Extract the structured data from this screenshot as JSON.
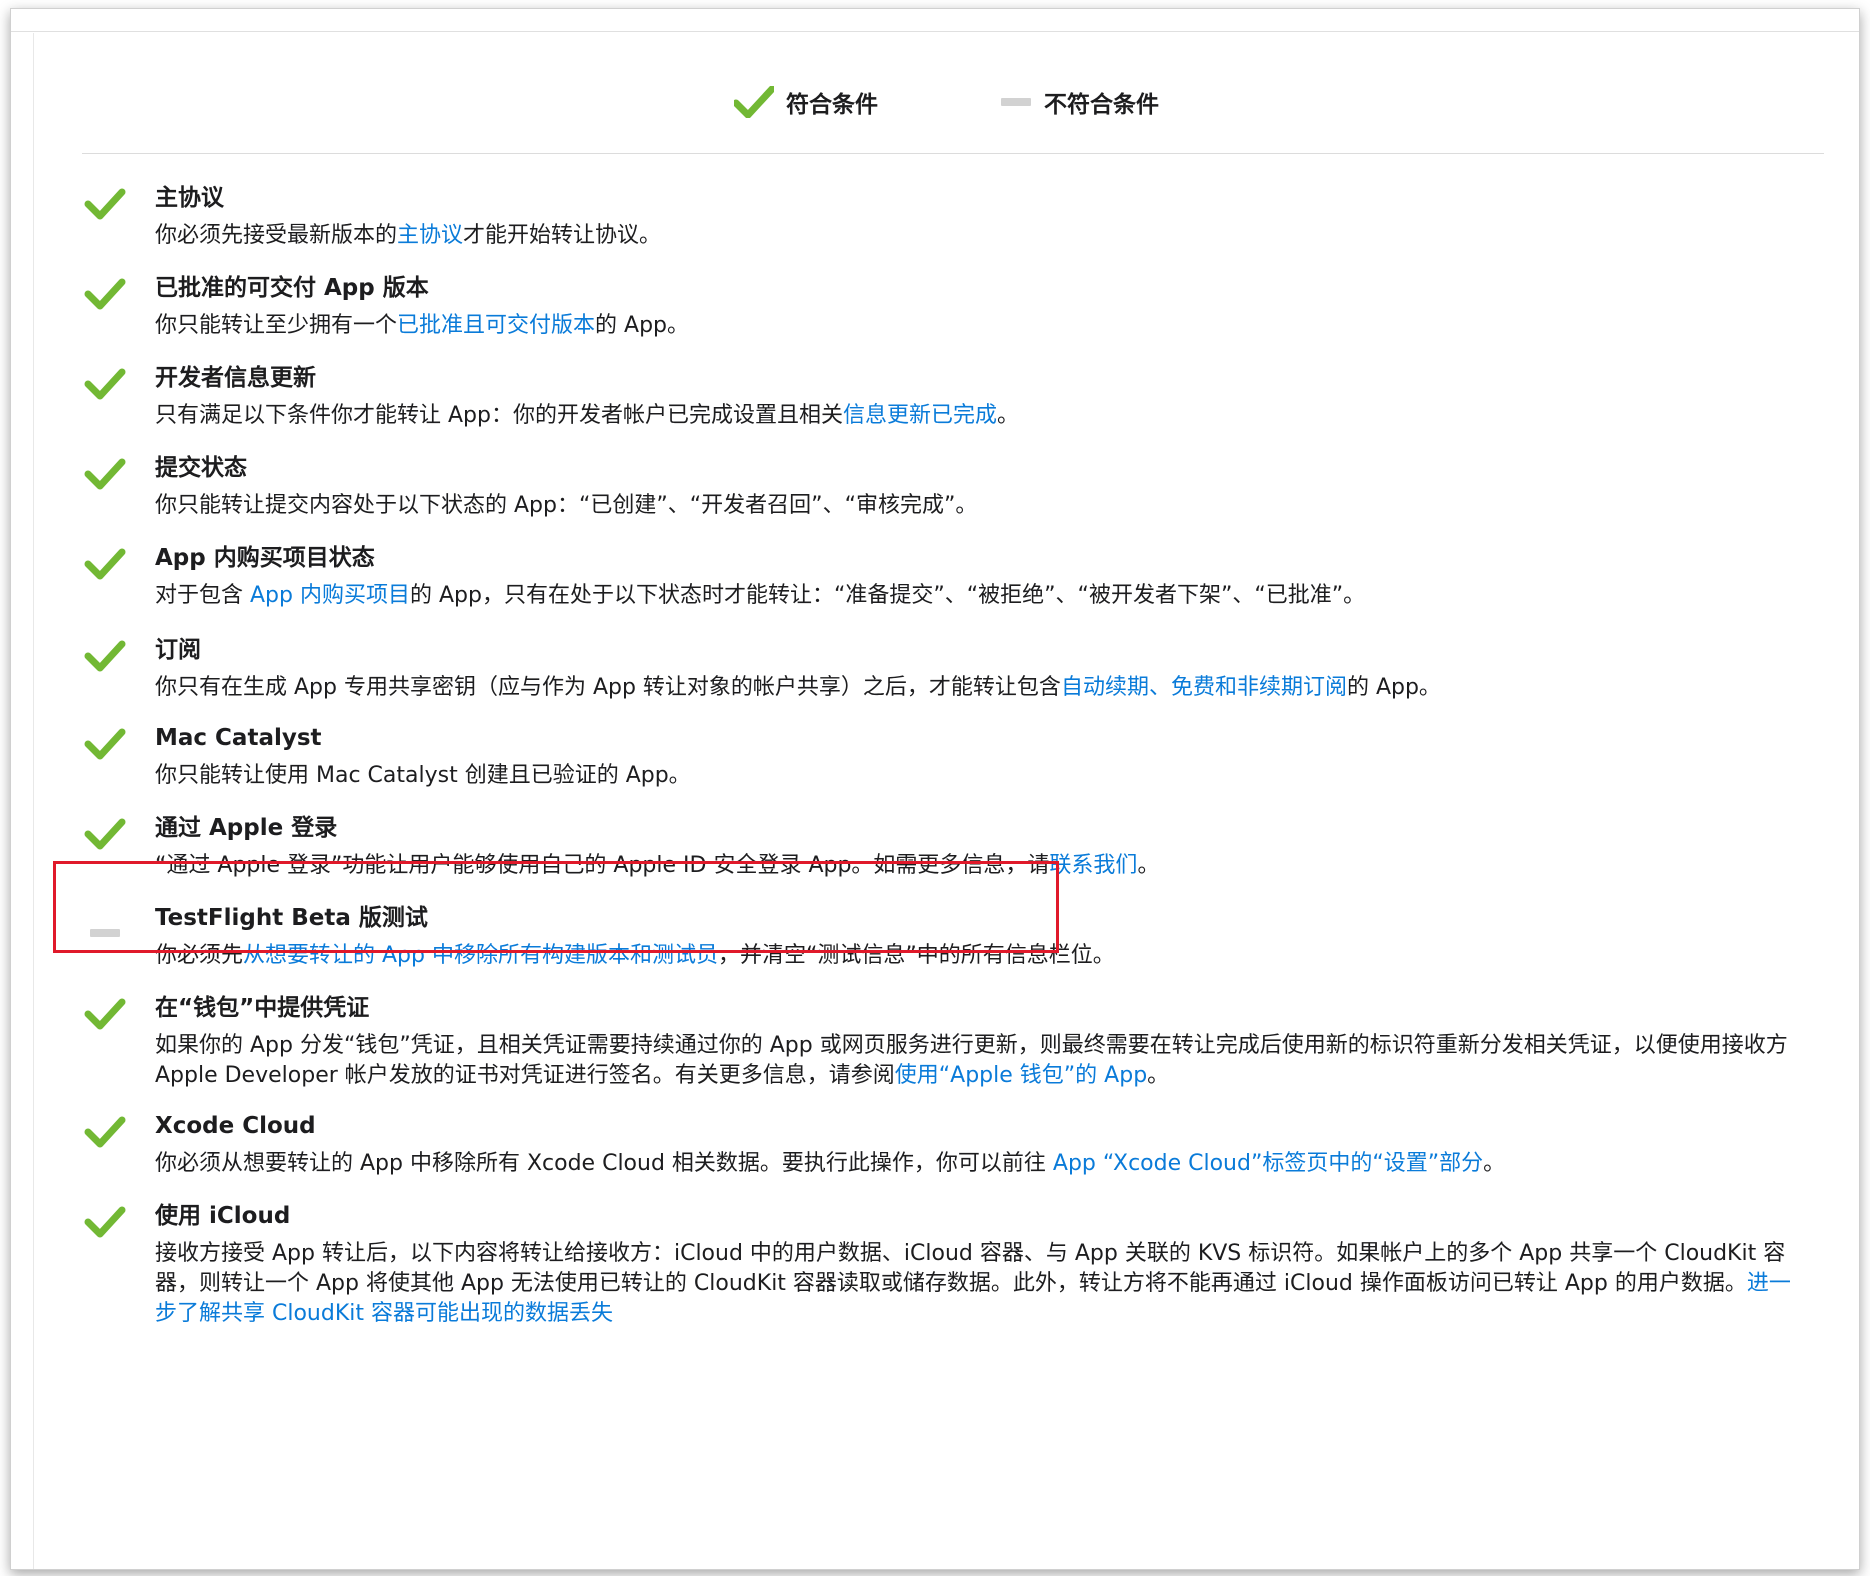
{
  "legend": {
    "eligible_label": "符合条件",
    "ineligible_label": "不符合条件"
  },
  "colors": {
    "check_green": "#72b834",
    "dash_gray": "#d2d2d2",
    "link_blue": "#0a7bd9",
    "highlight_red": "#e0192a"
  },
  "requirements": [
    {
      "status": "eligible",
      "title": "主协议",
      "desc": [
        {
          "t": "你必须先接受最新版本的"
        },
        {
          "t": "主协议",
          "link": true
        },
        {
          "t": "才能开始转让协议。"
        }
      ]
    },
    {
      "status": "eligible",
      "title": "已批准的可交付 App 版本",
      "desc": [
        {
          "t": "你只能转让至少拥有一个"
        },
        {
          "t": "已批准且可交付版本",
          "link": true
        },
        {
          "t": "的 App。"
        }
      ]
    },
    {
      "status": "eligible",
      "title": "开发者信息更新",
      "desc": [
        {
          "t": "只有满足以下条件你才能转让 App：你的开发者帐户已完成设置且相关"
        },
        {
          "t": "信息更新已完成",
          "link": true
        },
        {
          "t": "。"
        }
      ]
    },
    {
      "status": "eligible",
      "title": "提交状态",
      "desc": [
        {
          "t": "你只能转让提交内容处于以下状态的 App：“已创建”、“开发者召回”、“审核完成”。"
        }
      ]
    },
    {
      "status": "eligible",
      "title": "App 内购买项目状态",
      "desc": [
        {
          "t": "对于包含 "
        },
        {
          "t": "App 内购买项目",
          "link": true
        },
        {
          "t": "的 App，只有在处于以下状态时才能转让：“准备提交”、“被拒绝”、“被开发者下架”、“已批准”。"
        }
      ]
    },
    {
      "status": "eligible",
      "title": "订阅",
      "desc": [
        {
          "t": "你只有在生成 App 专用共享密钥（应与作为 App 转让对象的帐户共享）之后，才能转让包含"
        },
        {
          "t": "自动续期、免费和非续期订阅",
          "link": true
        },
        {
          "t": "的 App。"
        }
      ]
    },
    {
      "status": "eligible",
      "title": "Mac Catalyst",
      "desc": [
        {
          "t": "你只能转让使用 Mac Catalyst 创建且已验证的 App。"
        }
      ]
    },
    {
      "status": "eligible",
      "title": "通过 Apple 登录",
      "desc": [
        {
          "t": "“通过 Apple 登录”功能让用户能够使用自己的 Apple ID 安全登录 App。如需更多信息，请"
        },
        {
          "t": "联系我们",
          "link": true
        },
        {
          "t": "。"
        }
      ]
    },
    {
      "status": "ineligible",
      "title": "TestFlight Beta 版测试",
      "desc": [
        {
          "t": "你必须先"
        },
        {
          "t": "从想要转让的 App 中移除所有构建版本和测试员",
          "link": true
        },
        {
          "t": "，并清空“测试信息”中的所有信息栏位。"
        }
      ]
    },
    {
      "status": "eligible",
      "title": "在“钱包”中提供凭证",
      "desc": [
        {
          "t": "如果你的 App 分发“钱包”凭证，且相关凭证需要持续通过你的 App 或网页服务进行更新，则最终需要在转让完成后使用新的标识符重新分发相关凭证，以便使用接收方 Apple Developer 帐户发放的证书对凭证进行签名。有关更多信息，请参阅"
        },
        {
          "t": "使用“Apple 钱包”的 App",
          "link": true
        },
        {
          "t": "。"
        }
      ]
    },
    {
      "status": "eligible",
      "title": "Xcode Cloud",
      "desc": [
        {
          "t": "你必须从想要转让的 App 中移除所有 Xcode Cloud 相关数据。要执行此操作，你可以前往 "
        },
        {
          "t": "App “Xcode Cloud”标签页中的“设置”部分",
          "link": true
        },
        {
          "t": "。"
        }
      ]
    },
    {
      "status": "eligible",
      "title": "使用 iCloud",
      "desc": [
        {
          "t": "接收方接受 App 转让后，以下内容将转让给接收方：iCloud 中的用户数据、iCloud 容器、与 App 关联的 KVS 标识符。如果帐户上的多个 App 共享一个 CloudKit 容器，则转让一个 App 将使其他 App 无法使用已转让的 CloudKit 容器读取或储存数据。此外，转让方将不能再通过 iCloud 操作面板访问已转让 App 的用户数据。"
        },
        {
          "t": "进一步了解共享 CloudKit 容器可能出现的数据丢失",
          "link": true
        }
      ]
    }
  ]
}
